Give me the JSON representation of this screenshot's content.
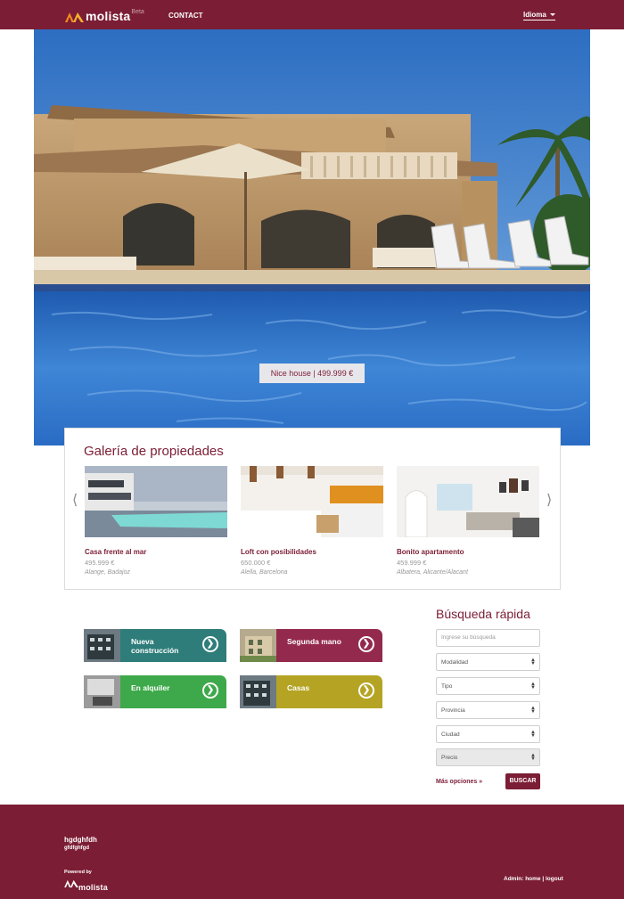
{
  "brand": {
    "name": "molista",
    "badge": "Beta",
    "accent": "#7b1d34",
    "logo_color": "#f08a1e"
  },
  "nav": {
    "contact": "CONTACT",
    "language": "Idioma"
  },
  "hero": {
    "caption": "Nice house | 499.999 €"
  },
  "gallery": {
    "title": "Galería de propiedades",
    "prev_icon": "chevron-left-icon",
    "next_icon": "chevron-right-icon",
    "items": [
      {
        "title": "Casa frente al mar",
        "price": "495.999 €",
        "location": "Alange, Badajoz"
      },
      {
        "title": "Loft con posibilidades",
        "price": "650.000 €",
        "location": "Alella, Barcelona"
      },
      {
        "title": "Bonito apartamento",
        "price": "459.999 €",
        "location": "Albatera, Alicante/Alacant"
      }
    ]
  },
  "categories": [
    {
      "label_1": "Nueva",
      "label_2": "construcción",
      "color": "#2e7d7a"
    },
    {
      "label_1": "Segunda mano",
      "label_2": "",
      "color": "#94294e"
    },
    {
      "label_1": "En alquiler",
      "label_2": "",
      "color": "#3ea94a"
    },
    {
      "label_1": "Casas",
      "label_2": "",
      "color": "#b5a424"
    }
  ],
  "search": {
    "title": "Búsqueda rápida",
    "placeholder": "Ingrese su búsqueda",
    "selects": [
      "Modalidad",
      "Tipo",
      "Provincia",
      "Ciudad",
      "Precio"
    ],
    "more": "Más opciones »",
    "button": "BUSCAR"
  },
  "footer": {
    "name": "hgdghfdh",
    "sub": "gfdfghfgd",
    "powered": "Powered by",
    "admin": "Admin: home | logout"
  }
}
